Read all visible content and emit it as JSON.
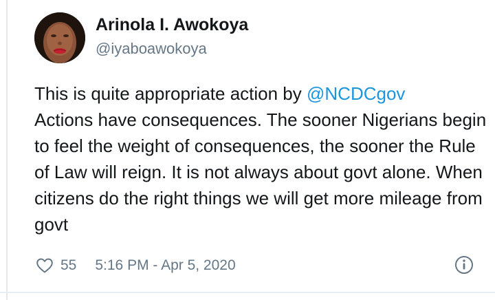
{
  "author": {
    "display_name": "Arinola I. Awokoya",
    "handle": "@iyaboawokoya"
  },
  "tweet": {
    "text_before_mention": "This is quite appropriate action by ",
    "mention": "@NCDCgov",
    "text_after_mention": "\nActions have consequences. The sooner Nigerians begin to feel the weight of consequences, the sooner the Rule of Law will reign. It is not always about govt alone. When citizens do the right things we will get more mileage from govt"
  },
  "footer": {
    "like_count": "55",
    "timestamp": "5:16 PM - Apr 5, 2020"
  },
  "icons": {
    "like": "heart-outline-icon",
    "info": "info-circle-icon"
  },
  "colors": {
    "link": "#1b95e0",
    "secondary_text": "#657786",
    "primary_text": "#14171a"
  }
}
